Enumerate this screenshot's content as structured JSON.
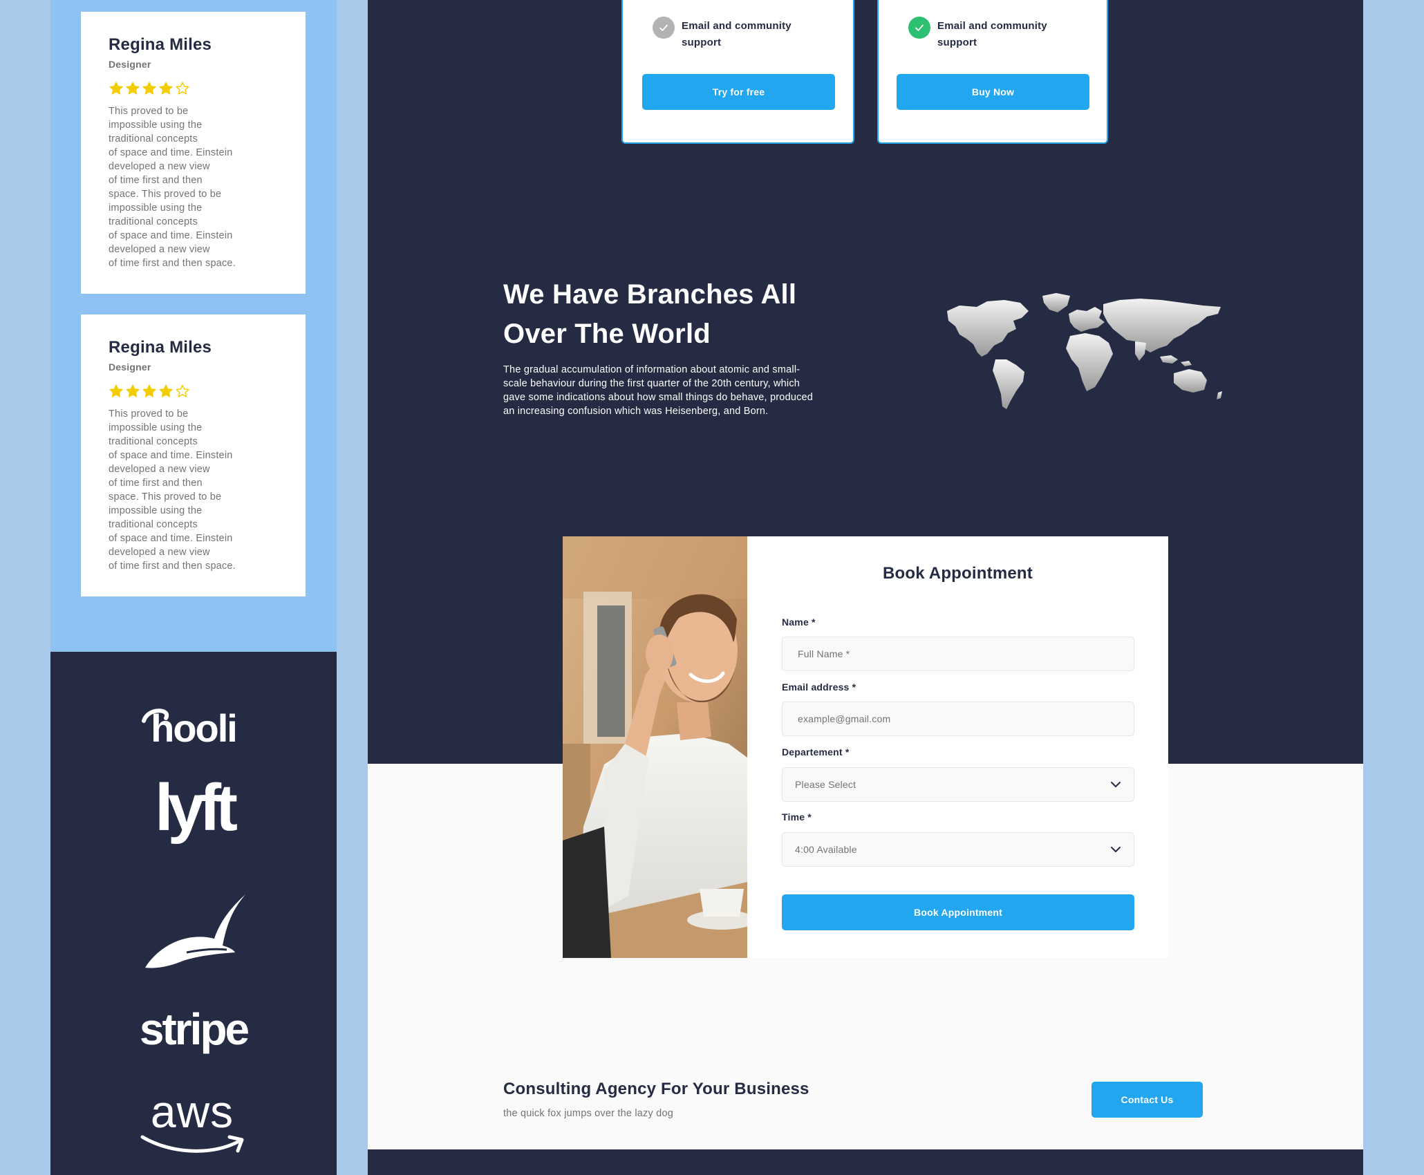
{
  "testimonials": [
    {
      "name": "Regina Miles",
      "role": "Designer",
      "rating": 4,
      "max_rating": 5,
      "text": "This proved to be\nimpossible using the\ntraditional concepts\nof space and time. Einstein\ndeveloped a new view\nof time first and then\nspace. This proved to be\nimpossible using the\ntraditional concepts\nof space and time. Einstein\ndeveloped a new view\nof time first and then space."
    },
    {
      "name": "Regina Miles",
      "role": "Designer",
      "rating": 4,
      "max_rating": 5,
      "text": "This proved to be\nimpossible using the\ntraditional concepts\nof space and time. Einstein\ndeveloped a new view\nof time first and then\nspace. This proved to be\nimpossible using the\ntraditional concepts\nof space and time. Einstein\ndeveloped a new view\nof time first and then space."
    }
  ],
  "brand_logos": [
    "hooli",
    "lyft",
    "robinhood",
    "stripe",
    "aws"
  ],
  "pricing": {
    "free": {
      "feature": "Email and community support",
      "button": "Try for free",
      "check_color": "#b2b2b2"
    },
    "paid": {
      "feature": "Email and community support",
      "button": "Buy Now",
      "check_color": "#2dc071"
    }
  },
  "branches": {
    "title": "We Have Branches All Over The World",
    "text": "The gradual accumulation of information about atomic and small-scale behaviour during the first quarter of the 20th century, which gave some indications about how small things do behave, produced an increasing confusion which was Heisenberg, and Born.",
    "map_icon": "world-map"
  },
  "appointment": {
    "title": "Book Appointment",
    "name_label": "Name *",
    "name_placeholder": "Full Name *",
    "email_label": "Email address *",
    "email_placeholder": "example@gmail.com",
    "department_label": "Departement *",
    "department_value": "Please Select",
    "time_label": "Time *",
    "time_value": "4:00 Available",
    "submit": "Book Appointment"
  },
  "cta": {
    "title": "Consulting Agency For Your Business",
    "subtitle": "the quick fox jumps over the lazy dog",
    "button": "Contact Us"
  },
  "colors": {
    "dark": "#252b42",
    "primary": "#23a6f0",
    "light_blue": "#8ec2f2",
    "page_bg": "#a9c9ea",
    "star": "#f3cd03",
    "success": "#2dc071",
    "muted": "#737373"
  }
}
